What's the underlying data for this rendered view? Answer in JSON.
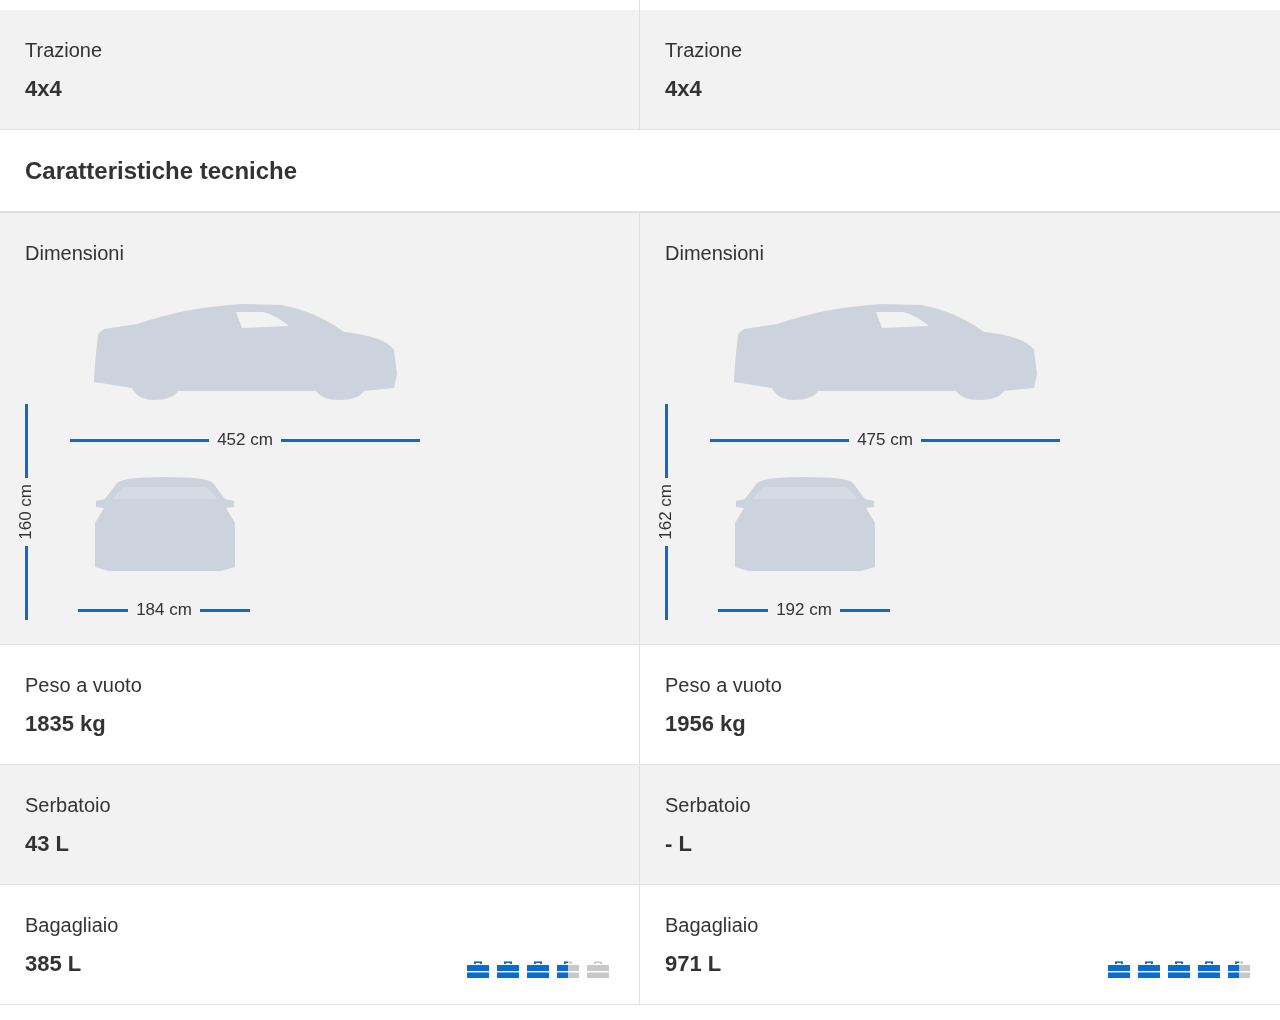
{
  "drive_row": {
    "cells": [
      {
        "label": "Trazione",
        "value": "4x4"
      },
      {
        "label": "Trazione",
        "value": "4x4"
      }
    ]
  },
  "section_title": "Caratteristiche tecniche",
  "spec_rows": [
    {
      "kind": "dimensions",
      "cells": [
        {
          "label": "Dimensioni",
          "length": "452 cm",
          "height": "160 cm",
          "width": "184 cm"
        },
        {
          "label": "Dimensioni",
          "length": "475 cm",
          "height": "162 cm",
          "width": "192 cm"
        }
      ]
    },
    {
      "kind": "value",
      "cells": [
        {
          "label": "Peso a vuoto",
          "value": "1835 kg"
        },
        {
          "label": "Peso a vuoto",
          "value": "1956 kg"
        }
      ]
    },
    {
      "kind": "value",
      "cells": [
        {
          "label": "Serbatoio",
          "value": "43 L"
        },
        {
          "label": "Serbatoio",
          "value": "- L"
        }
      ]
    },
    {
      "kind": "luggage",
      "cells": [
        {
          "label": "Bagagliaio",
          "value": "385 L",
          "stars": 3.5
        },
        {
          "label": "Bagagliaio",
          "value": "971 L",
          "stars": 4.5
        }
      ]
    }
  ]
}
